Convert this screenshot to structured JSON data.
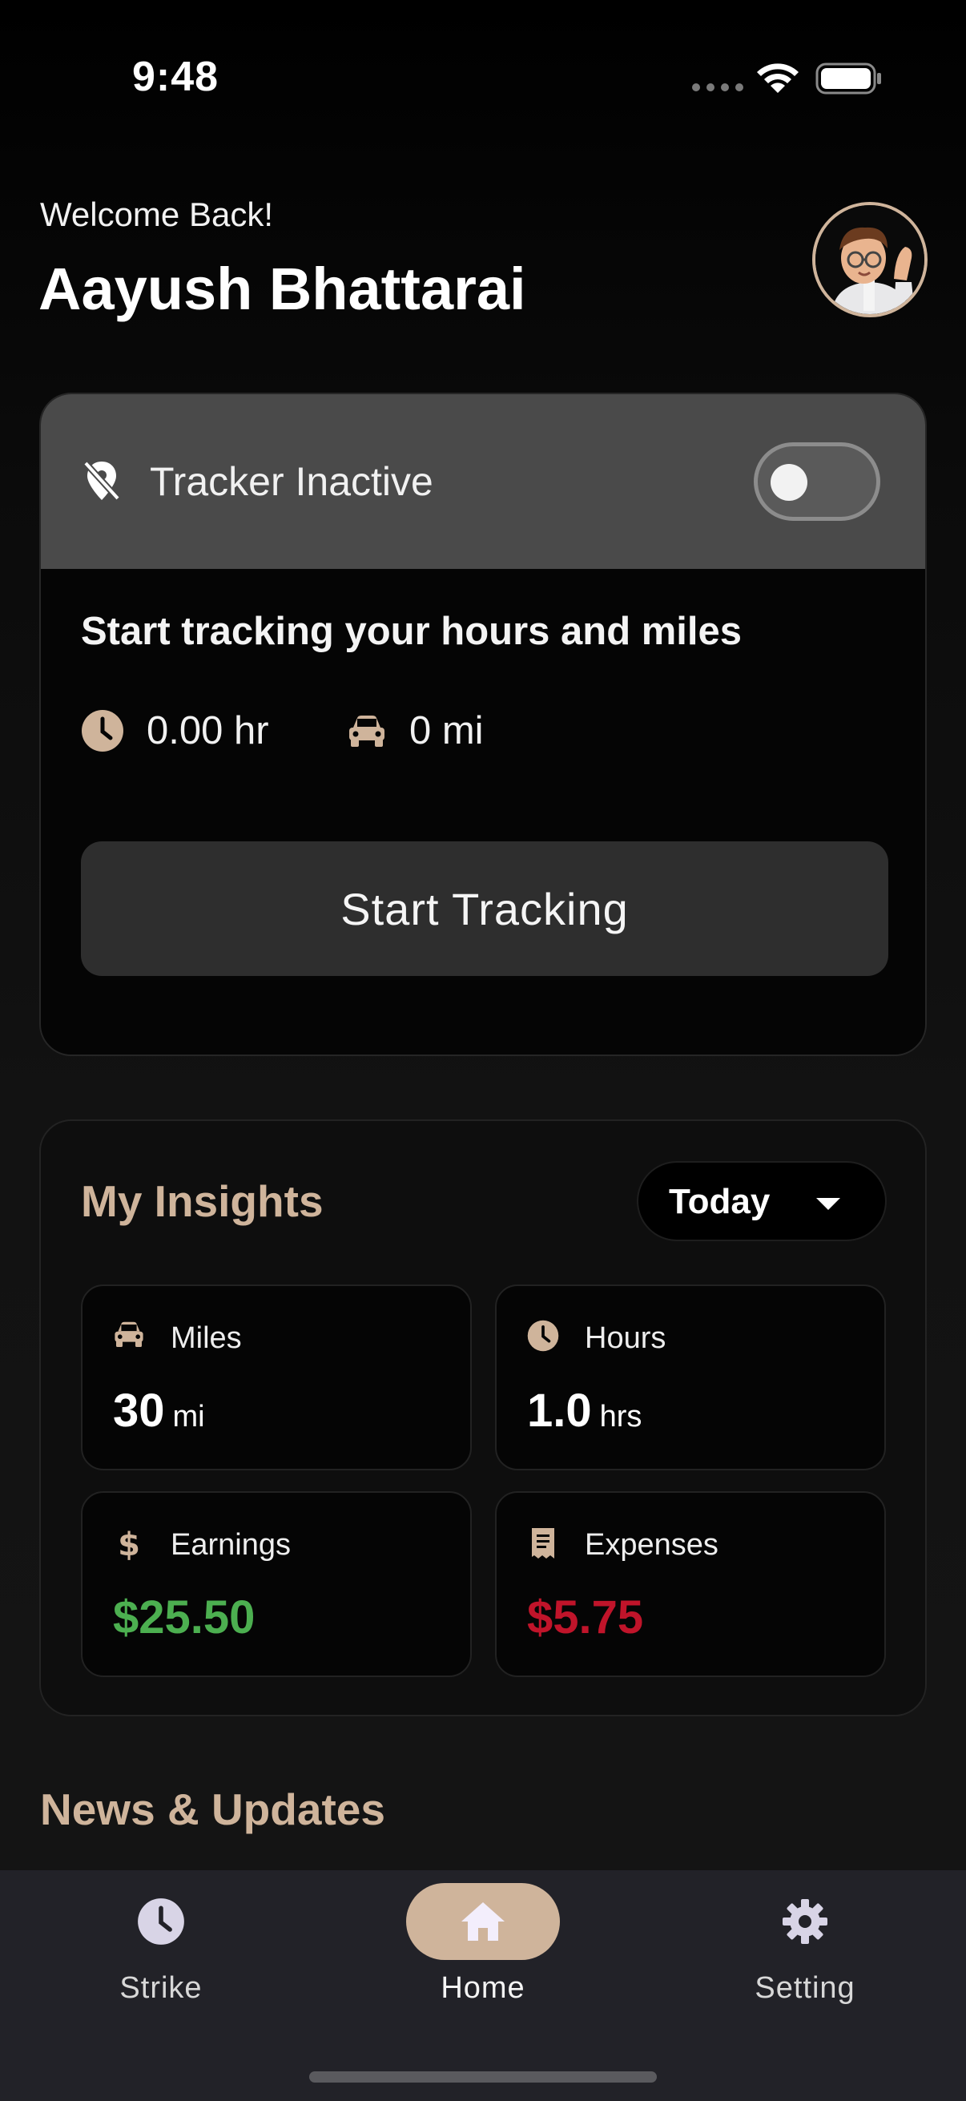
{
  "status_bar": {
    "time": "9:48"
  },
  "header": {
    "welcome": "Welcome Back!",
    "user_name": "Aayush Bhattarai",
    "avatar_icon": "memoji-avatar"
  },
  "tracker": {
    "status": "Tracker Inactive",
    "toggle_on": false,
    "heading": "Start tracking your hours and miles",
    "hours": "0.00 hr",
    "miles": "0 mi",
    "button": "Start Tracking"
  },
  "insights": {
    "title": "My Insights",
    "period": "Today",
    "miles": {
      "label": "Miles",
      "value": "30",
      "unit": "mi"
    },
    "hours": {
      "label": "Hours",
      "value": "1.0",
      "unit": "hrs"
    },
    "earnings": {
      "label": "Earnings",
      "value": "$25.50",
      "color": "#4caf50"
    },
    "expenses": {
      "label": "Expenses",
      "value": "$5.75",
      "color": "#c0142a"
    }
  },
  "news": {
    "title": "News & Updates"
  },
  "nav": {
    "items": [
      {
        "label": "Strike",
        "icon": "clock-icon"
      },
      {
        "label": "Home",
        "icon": "home-icon",
        "active": true
      },
      {
        "label": "Setting",
        "icon": "gear-icon"
      }
    ]
  },
  "accent_color": "#cfb49b"
}
